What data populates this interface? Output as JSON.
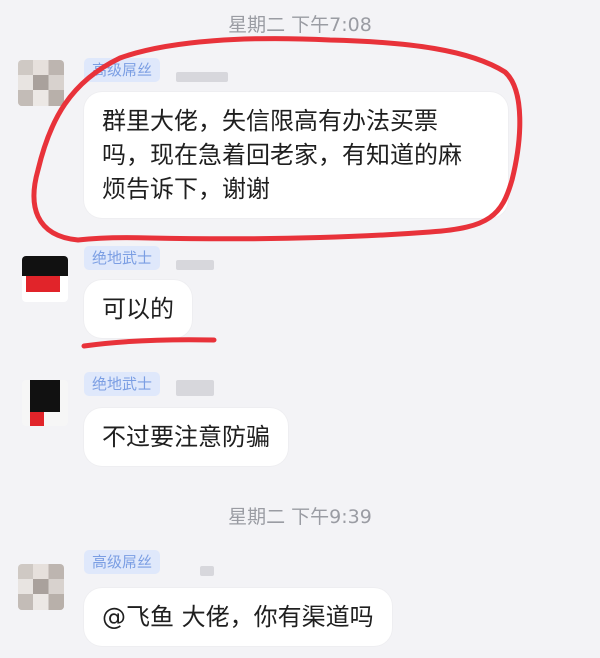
{
  "timestamps": [
    "星期二 下午7:08",
    "星期二 下午9:39"
  ],
  "messages": [
    {
      "sender": "高级屌丝",
      "lines": [
        "群里大佬，失信限高有办法买票",
        "吗，现在急着回老家，有知道的麻",
        "烦告诉下，谢谢"
      ]
    },
    {
      "sender": "绝地武士",
      "lines": [
        "可以的"
      ]
    },
    {
      "sender": "绝地武士",
      "lines": [
        "不过要注意防骗"
      ]
    },
    {
      "sender": "高级屌丝",
      "lines": [
        "@飞鱼 大佬，你有渠道吗"
      ]
    }
  ],
  "annotation_color": "#e8323a"
}
